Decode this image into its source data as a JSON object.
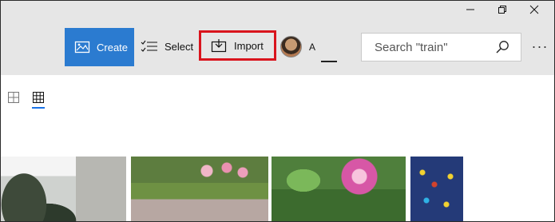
{
  "window_controls": [
    "minimize",
    "restore",
    "close"
  ],
  "toolbar": {
    "create_label": "Create",
    "select_label": "Select",
    "import_label": "Import",
    "account_label": "A",
    "search_placeholder": "Search \"train\"",
    "more_label": "···"
  },
  "view": {
    "modes": [
      "large-thumbnails",
      "small-thumbnails"
    ],
    "selected": "small-thumbnails"
  },
  "photos": [
    {
      "name": "tree-and-building"
    },
    {
      "name": "pink-lilies-garden"
    },
    {
      "name": "pink-lily-closeup"
    },
    {
      "name": "game-screenshot"
    }
  ],
  "colors": {
    "accent": "#2b7bd0",
    "highlight_border": "#d9141d",
    "toolbar_bg": "#e6e6e6"
  }
}
